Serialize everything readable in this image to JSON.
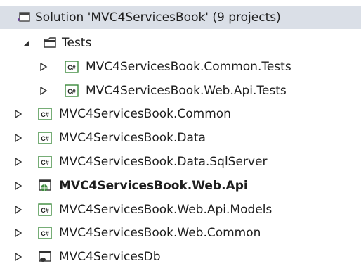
{
  "tree": {
    "solution": {
      "label": "Solution 'MVC4ServicesBook' (9 projects)",
      "icon": "solution-icon"
    },
    "folder": {
      "label": "Tests",
      "icon": "folder-icon",
      "expanded": true
    },
    "folder_children": [
      {
        "label": "MVC4ServicesBook.Common.Tests",
        "icon": "csharp-project-icon"
      },
      {
        "label": "MVC4ServicesBook.Web.Api.Tests",
        "icon": "csharp-project-icon"
      }
    ],
    "projects": [
      {
        "label": "MVC4ServicesBook.Common",
        "icon": "csharp-project-icon",
        "bold": false
      },
      {
        "label": "MVC4ServicesBook.Data",
        "icon": "csharp-project-icon",
        "bold": false
      },
      {
        "label": "MVC4ServicesBook.Data.SqlServer",
        "icon": "csharp-project-icon",
        "bold": false
      },
      {
        "label": "MVC4ServicesBook.Web.Api",
        "icon": "web-project-icon",
        "bold": true
      },
      {
        "label": "MVC4ServicesBook.Web.Api.Models",
        "icon": "csharp-project-icon",
        "bold": false
      },
      {
        "label": "MVC4ServicesBook.Web.Common",
        "icon": "csharp-project-icon",
        "bold": false
      },
      {
        "label": "MVC4ServicesDb",
        "icon": "database-project-icon",
        "bold": false
      }
    ]
  },
  "colors": {
    "selection": "#dadfe7",
    "icon_green": "#3c8a3c",
    "text": "#1e1e1e"
  }
}
